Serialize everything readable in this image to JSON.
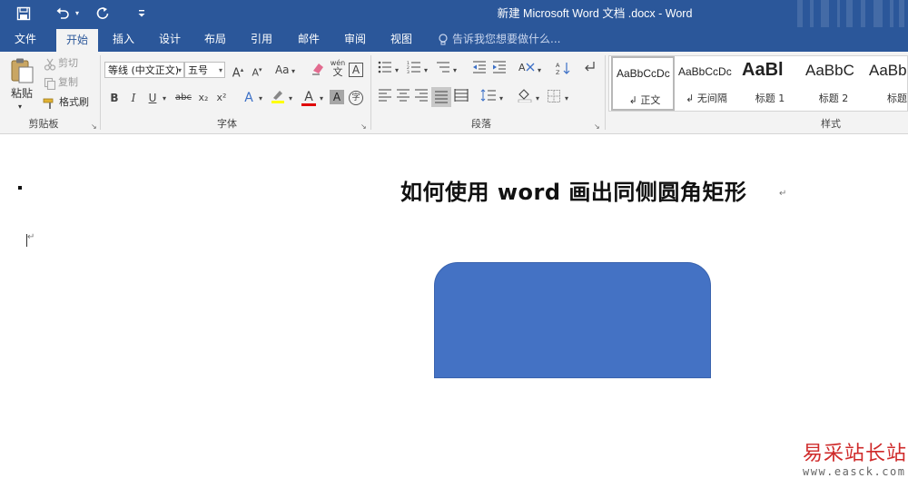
{
  "window": {
    "title": "新建 Microsoft Word 文档 .docx - Word",
    "accent_color": "#2b579a"
  },
  "quick_access": {
    "save_icon": "save-icon",
    "undo_icon": "undo-icon",
    "redo_icon": "redo-icon",
    "customize_icon": "customize-icon"
  },
  "tabs": [
    {
      "label": "文件"
    },
    {
      "label": "开始"
    },
    {
      "label": "插入"
    },
    {
      "label": "设计"
    },
    {
      "label": "布局"
    },
    {
      "label": "引用"
    },
    {
      "label": "邮件"
    },
    {
      "label": "审阅"
    },
    {
      "label": "视图"
    }
  ],
  "active_tab": "开始",
  "tell_me": "告诉我您想要做什么...",
  "ribbon": {
    "clipboard": {
      "label": "剪贴板",
      "paste": "粘贴",
      "cut": "剪切",
      "copy": "复制",
      "format_painter": "格式刷"
    },
    "font": {
      "label": "字体",
      "font_name": "等线 (中文正文)",
      "font_size": "五号",
      "change_case": "Aa",
      "phonetic_top": "wén",
      "phonetic_bottom": "文",
      "bold": "B",
      "italic": "I",
      "underline": "U",
      "strike": "abc",
      "subscript": "x₂",
      "superscript": "x²",
      "char_shading": "A",
      "enclose": "字"
    },
    "paragraph": {
      "label": "段落"
    },
    "styles": {
      "label": "样式",
      "items": [
        {
          "preview": "AaBbCcDc",
          "name": "↲ 正文"
        },
        {
          "preview": "AaBbCcDc",
          "name": "↲ 无间隔"
        },
        {
          "preview": "AaBl",
          "name": "标题 1"
        },
        {
          "preview": "AaBbC",
          "name": "标题 2"
        },
        {
          "preview": "AaBb",
          "name": "标题"
        }
      ]
    }
  },
  "document": {
    "heading": "如何使用 word 画出同侧圆角矩形",
    "paragraph_mark": "↵",
    "shape_color": "#4472c4"
  },
  "watermark": {
    "site_name": "易采站长站",
    "url": "www.easck.com"
  }
}
